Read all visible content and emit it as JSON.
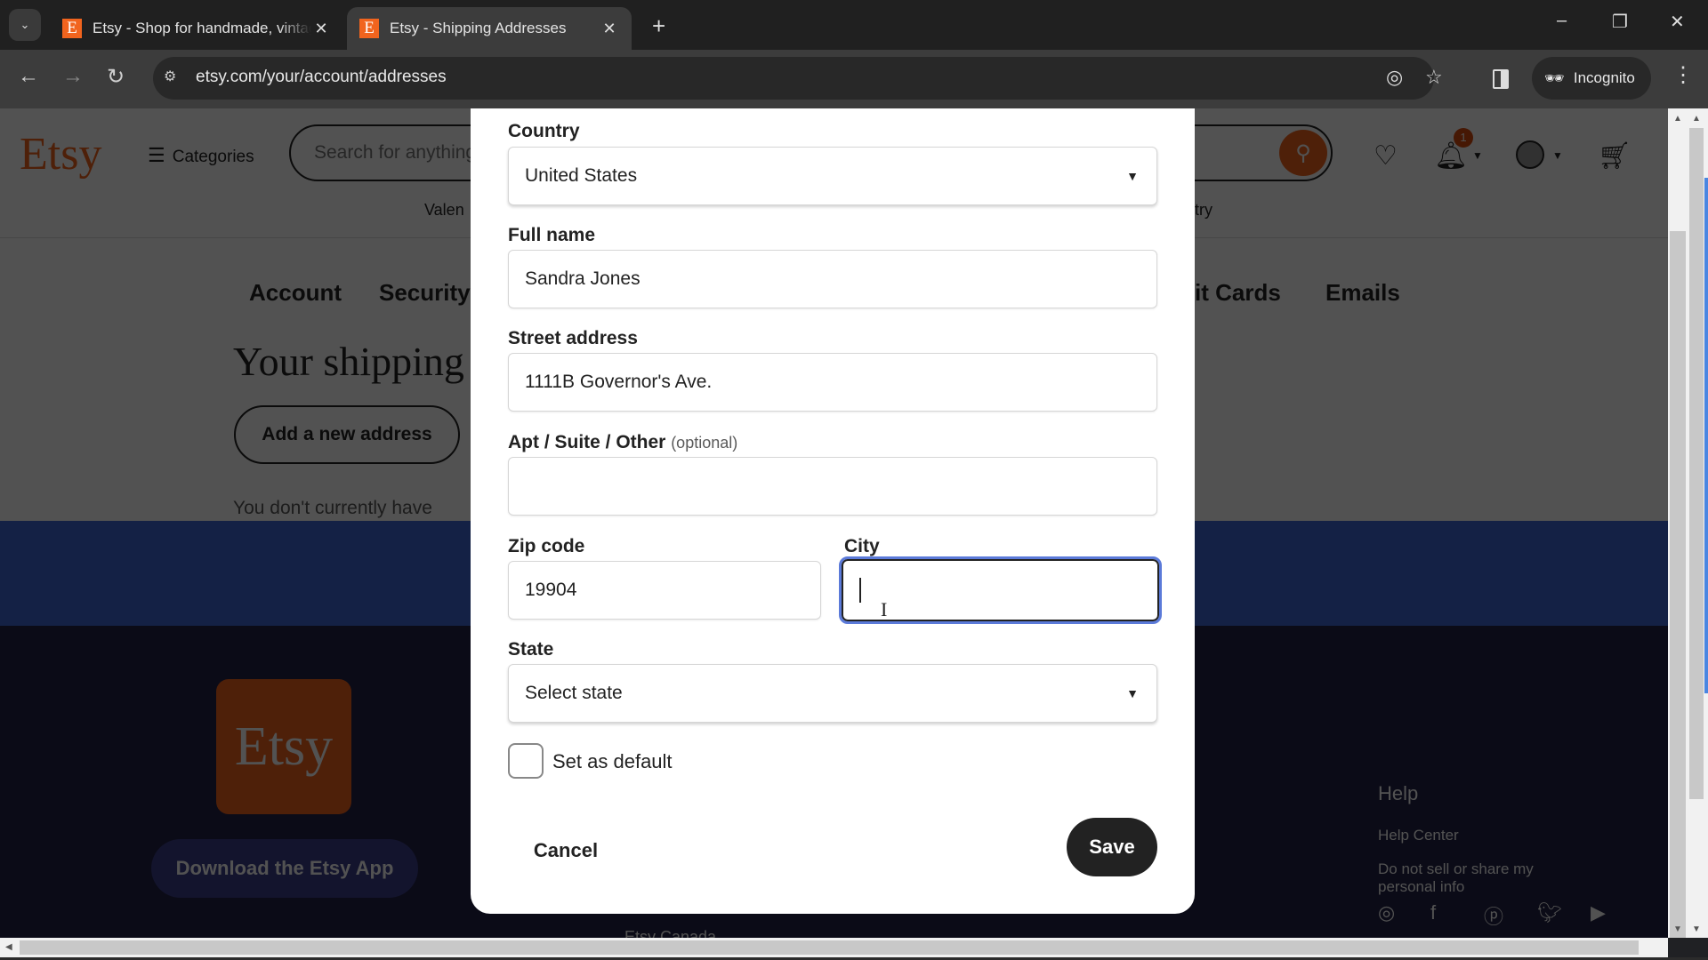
{
  "browser": {
    "tabs": [
      {
        "title": "Etsy - Shop for handmade, vintage",
        "favicon": "E",
        "active": false
      },
      {
        "title": "Etsy - Shipping Addresses",
        "favicon": "E",
        "active": true
      }
    ],
    "new_tab_label": "+",
    "url": "etsy.com/your/account/addresses",
    "incognito_label": "Incognito",
    "window_controls": {
      "minimize": "–",
      "restore": "❐",
      "close": "✕"
    }
  },
  "page": {
    "logo": "Etsy",
    "categories_label": "Categories",
    "search_placeholder": "Search for anything",
    "notification_count": "1",
    "subnav": {
      "left_fragment": "Valen",
      "right_fragment": "try"
    },
    "account_tabs": {
      "account": "Account",
      "security": "Security",
      "cards_fragment": "it Cards",
      "emails": "Emails"
    },
    "heading_fragment": "Your shipping",
    "add_address_label": "Add a new address",
    "no_address_fragment": "You don't currently have",
    "footer": {
      "app_logo": "Etsy",
      "download_app_label": "Download the Etsy App",
      "help_title": "Help",
      "help_links": [
        "Help Center",
        "Do not sell or share my personal info"
      ],
      "bottom_link_fragment": "Etsy Canada",
      "social_icons": [
        "instagram-icon",
        "facebook-icon",
        "pinterest-icon",
        "twitter-icon",
        "youtube-icon"
      ]
    }
  },
  "modal": {
    "country": {
      "label": "Country",
      "value": "United States"
    },
    "full_name": {
      "label": "Full name",
      "value": "Sandra Jones"
    },
    "street": {
      "label": "Street address",
      "value": "1111B Governor's Ave."
    },
    "apt": {
      "label": "Apt / Suite / Other",
      "optional": "(optional)",
      "value": ""
    },
    "zip": {
      "label": "Zip code",
      "value": "19904"
    },
    "city": {
      "label": "City",
      "value": ""
    },
    "state": {
      "label": "State",
      "value": "Select state"
    },
    "set_default": {
      "label": "Set as default",
      "checked": false
    },
    "cancel_label": "Cancel",
    "save_label": "Save"
  },
  "colors": {
    "brand_orange": "#f1641e",
    "focus_ring": "#5b7ad9",
    "save_bg": "#222222"
  }
}
